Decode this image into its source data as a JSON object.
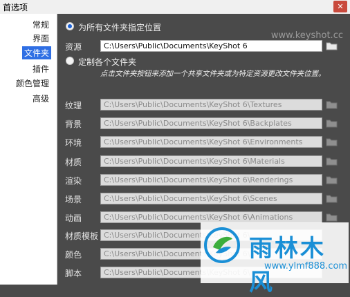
{
  "window": {
    "title": "首选项",
    "close_glyph": "✕"
  },
  "sidebar": {
    "items": [
      {
        "label": "常规",
        "active": false
      },
      {
        "label": "界面",
        "active": false
      },
      {
        "label": "文件夹",
        "active": true
      },
      {
        "label": "插件",
        "active": false
      },
      {
        "label": "颜色管理",
        "active": false
      },
      {
        "label": "高级",
        "active": false
      }
    ]
  },
  "watermark": "www.keyshot.cc",
  "options": {
    "all_folders_label": "为所有文件夹指定位置",
    "all_folders_selected": true,
    "resource_label": "资源",
    "resource_path": "C:\\Users\\Public\\Documents\\KeyShot 6",
    "custom_label": "定制各个文件夹",
    "custom_selected": false,
    "hint": "点击文件夹按钮来添加一个共享文件夹或为特定资源更改文件夹位置。"
  },
  "folders": [
    {
      "label": "纹理",
      "path": "C:\\Users\\Public\\Documents\\KeyShot 6\\Textures"
    },
    {
      "label": "背景",
      "path": "C:\\Users\\Public\\Documents\\KeyShot 6\\Backplates"
    },
    {
      "label": "环境",
      "path": "C:\\Users\\Public\\Documents\\KeyShot 6\\Environments"
    },
    {
      "label": "材质",
      "path": "C:\\Users\\Public\\Documents\\KeyShot 6\\Materials"
    },
    {
      "label": "渲染",
      "path": "C:\\Users\\Public\\Documents\\KeyShot 6\\Renderings"
    },
    {
      "label": "场景",
      "path": "C:\\Users\\Public\\Documents\\KeyShot 6\\Scenes"
    },
    {
      "label": "动画",
      "path": "C:\\Users\\Public\\Documents\\KeyShot 6\\Animations"
    },
    {
      "label": "材质模板",
      "path": "C:\\Users\\Public\\Documents\\KeyShot 6\\"
    },
    {
      "label": "颜色",
      "path": "C:\\Users\\Public\\Documents\\KeyShot 6\\"
    },
    {
      "label": "脚本",
      "path": "C:\\Users\\Public\\Documents\\KeyShot 6\\"
    }
  ],
  "logo": {
    "brand": "雨林木风",
    "url": "www.ylmf888.com"
  },
  "colors": {
    "accent": "#2f6fe4",
    "panel": "#4a4a4a",
    "brand": "#1a8fd6"
  }
}
